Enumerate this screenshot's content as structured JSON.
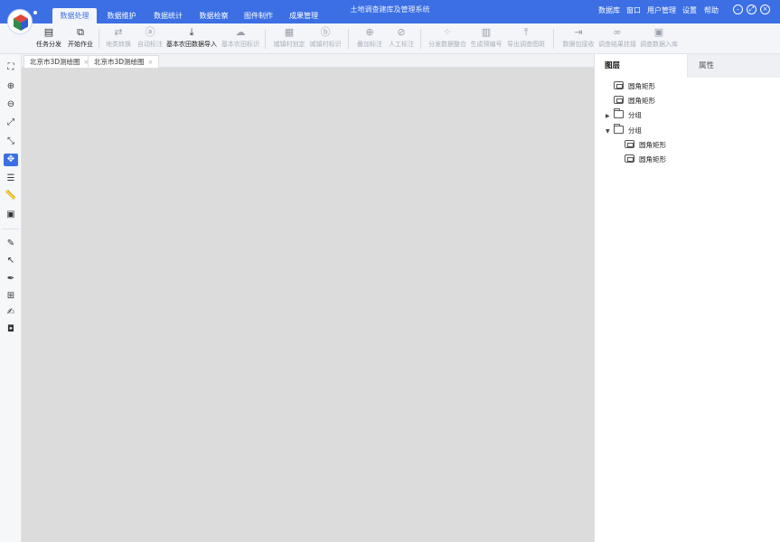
{
  "app": {
    "title": "土地调查建库及管理系统",
    "accent": "#3b6fe3",
    "canvas_color": "#dcdcdc"
  },
  "menu": {
    "tabs": [
      {
        "label": "数据处理",
        "active": true
      },
      {
        "label": "数据维护",
        "active": false
      },
      {
        "label": "数据统计",
        "active": false
      },
      {
        "label": "数据检察",
        "active": false
      },
      {
        "label": "图件制作",
        "active": false
      },
      {
        "label": "成果管理",
        "active": false
      }
    ],
    "links": [
      "数据库",
      "窗口",
      "用户管理",
      "设置",
      "帮助"
    ]
  },
  "toolbar": {
    "items": [
      {
        "label": "任务分发",
        "icon": "table-icon",
        "enabled": true
      },
      {
        "label": "开始作业",
        "icon": "frame-icon",
        "enabled": true
      },
      {
        "label": "地类转换",
        "icon": "swap-icon",
        "enabled": false
      },
      {
        "label": "自动标注",
        "icon": "circle-a-icon",
        "enabled": false
      },
      {
        "label": "基本农田数据导入",
        "icon": "download-icon",
        "enabled": true
      },
      {
        "label": "基本农田标识",
        "icon": "cloud-icon",
        "enabled": false
      },
      {
        "label": "城镇村划定",
        "icon": "building-icon",
        "enabled": false
      },
      {
        "label": "城镇村标识",
        "icon": "circle-b-icon",
        "enabled": false
      },
      {
        "label": "叠加标注",
        "icon": "plus-circle-icon",
        "enabled": false
      },
      {
        "label": "人工标注",
        "icon": "compass-icon",
        "enabled": false
      },
      {
        "label": "分发数据整合",
        "icon": "grid-icon",
        "enabled": false
      },
      {
        "label": "生成预编号",
        "icon": "barcode-icon",
        "enabled": false
      },
      {
        "label": "导出调查图斑",
        "icon": "upload-icon",
        "enabled": false
      },
      {
        "label": "数据包接收",
        "icon": "import-icon",
        "enabled": false
      },
      {
        "label": "调查结果挂接",
        "icon": "link-icon",
        "enabled": false
      },
      {
        "label": "调查数据入库",
        "icon": "archive-icon",
        "enabled": false
      }
    ]
  },
  "left_tools": [
    {
      "name": "full-extent-icon",
      "glyph": "⛶",
      "active": false
    },
    {
      "name": "zoom-in-icon",
      "glyph": "⊕",
      "active": false
    },
    {
      "name": "zoom-out-icon",
      "glyph": "⊖",
      "active": false
    },
    {
      "name": "expand-icon",
      "glyph": "⤢",
      "active": false
    },
    {
      "name": "shrink-icon",
      "glyph": "⤡",
      "active": false
    },
    {
      "name": "pan-icon",
      "glyph": "✥",
      "active": true
    },
    {
      "name": "list-icon",
      "glyph": "☰",
      "active": false
    },
    {
      "name": "ruler-icon",
      "glyph": "📏",
      "active": false
    },
    {
      "name": "select-frame-icon",
      "glyph": "▣",
      "active": false
    },
    {
      "name": "edit-icon",
      "glyph": "✎",
      "active": false
    },
    {
      "name": "pointer-icon",
      "glyph": "↖",
      "active": false
    },
    {
      "name": "pen-icon",
      "glyph": "✒",
      "active": false
    },
    {
      "name": "node-icon",
      "glyph": "⊞",
      "active": false
    },
    {
      "name": "edit-shape-icon",
      "glyph": "✍",
      "active": false
    },
    {
      "name": "bounding-box-icon",
      "glyph": "◘",
      "active": false
    }
  ],
  "doc_tabs": [
    {
      "label": "北京市3D测绘图",
      "close": "×"
    },
    {
      "label": "北京市3D测绘图",
      "close": "×"
    }
  ],
  "panel": {
    "tabs": [
      {
        "label": "图层",
        "active": true
      },
      {
        "label": "属性",
        "active": false
      }
    ],
    "tree": [
      {
        "label": "圆角矩形",
        "type": "shape",
        "level": 0,
        "caret": ""
      },
      {
        "label": "圆角矩形",
        "type": "shape",
        "level": 0,
        "caret": ""
      },
      {
        "label": "分组",
        "type": "folder",
        "level": 0,
        "caret": "▶"
      },
      {
        "label": "分组",
        "type": "folder",
        "level": 0,
        "caret": "▼"
      },
      {
        "label": "圆角矩形",
        "type": "shape",
        "level": 1,
        "caret": ""
      },
      {
        "label": "圆角矩形",
        "type": "shape",
        "level": 1,
        "caret": ""
      }
    ]
  }
}
